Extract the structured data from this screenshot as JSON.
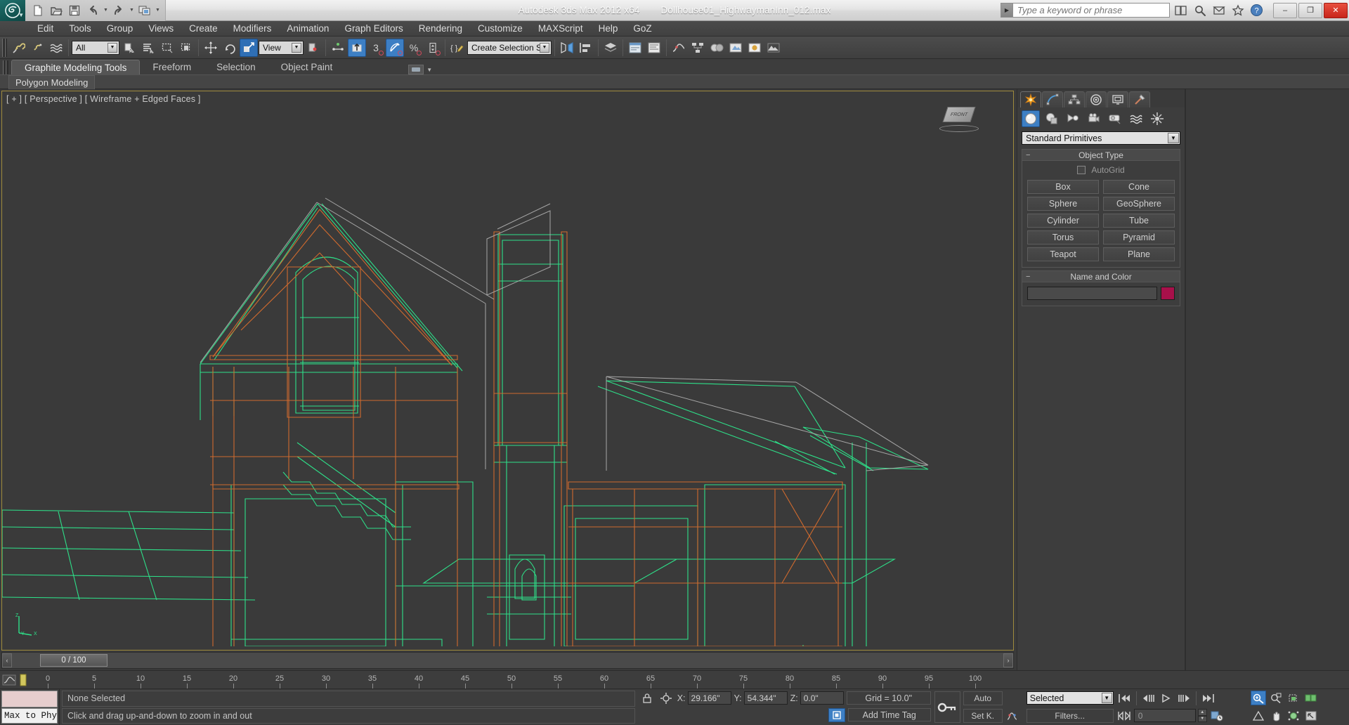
{
  "titlebar": {
    "app_title": "Autodesk 3ds Max  2012 x64",
    "file_name": "Dollhouse01_HighwaymanInn_012.max",
    "search_placeholder": "Type a keyword or phrase",
    "quick_access": [
      {
        "name": "new-file-icon",
        "label": "New"
      },
      {
        "name": "open-file-icon",
        "label": "Open"
      },
      {
        "name": "save-file-icon",
        "label": "Save"
      },
      {
        "name": "undo-icon",
        "label": "Undo"
      },
      {
        "name": "redo-icon",
        "label": "Redo"
      },
      {
        "name": "project-folder-icon",
        "label": "Set Project Folder"
      }
    ],
    "window_buttons": [
      "minimize",
      "restore",
      "close"
    ],
    "minimize_glyph": "–",
    "restore_glyph": "❐",
    "close_glyph": "✕"
  },
  "menu": {
    "items": [
      {
        "label": "Edit"
      },
      {
        "label": "Tools"
      },
      {
        "label": "Group"
      },
      {
        "label": "Views"
      },
      {
        "label": "Create"
      },
      {
        "label": "Modifiers"
      },
      {
        "label": "Animation"
      },
      {
        "label": "Graph Editors"
      },
      {
        "label": "Rendering"
      },
      {
        "label": "Customize"
      },
      {
        "label": "MAXScript"
      },
      {
        "label": "Help"
      },
      {
        "label": "GoZ"
      }
    ]
  },
  "toolbar": {
    "selection_filter_value": "All",
    "reference_coord_value": "View",
    "named_selection_value": "Create Selection Se",
    "snap_count_label": "3",
    "percent_label": "%",
    "curly_label": "{ }"
  },
  "ribbon": {
    "tabs": [
      {
        "label": "Graphite Modeling Tools",
        "active": true
      },
      {
        "label": "Freeform",
        "active": false
      },
      {
        "label": "Selection",
        "active": false
      },
      {
        "label": "Object Paint",
        "active": false
      }
    ],
    "subtab": "Polygon Modeling"
  },
  "viewport": {
    "label": "[ + ] [ Perspective ] [ Wireframe + Edged Faces ]",
    "viewcube_face": "FRONT",
    "axis_labels": {
      "x": "X",
      "y": "Y",
      "z": "Z"
    },
    "colors": {
      "background": "#3a3a3a",
      "border_active": "#9f8b3d",
      "wire_green": "#2ee089",
      "wire_orange": "#cf6a2e",
      "wire_gray": "#b9b9b9"
    }
  },
  "command_panel": {
    "tabs": [
      {
        "name": "create-tab",
        "icon": "star-icon",
        "active": true
      },
      {
        "name": "modify-tab",
        "icon": "curve-icon",
        "active": false
      },
      {
        "name": "hierarchy-tab",
        "icon": "hierarchy-icon",
        "active": false
      },
      {
        "name": "motion-tab",
        "icon": "wheel-icon",
        "active": false
      },
      {
        "name": "display-tab",
        "icon": "display-icon",
        "active": false
      },
      {
        "name": "utilities-tab",
        "icon": "hammer-icon",
        "active": false
      }
    ],
    "categories": [
      {
        "name": "geometry-category",
        "icon": "sphere-icon",
        "active": true
      },
      {
        "name": "shapes-category",
        "icon": "shapes-icon",
        "active": false
      },
      {
        "name": "lights-category",
        "icon": "light-icon",
        "active": false
      },
      {
        "name": "cameras-category",
        "icon": "camera-icon",
        "active": false
      },
      {
        "name": "helpers-category",
        "icon": "tape-icon",
        "active": false
      },
      {
        "name": "space-warps-category",
        "icon": "waves-icon",
        "active": false
      },
      {
        "name": "systems-category",
        "icon": "systems-icon",
        "active": false
      }
    ],
    "primitive_dropdown": "Standard Primitives",
    "object_type": {
      "title": "Object Type",
      "autogrid_label": "AutoGrid",
      "autogrid_checked": false,
      "buttons": [
        "Box",
        "Cone",
        "Sphere",
        "GeoSphere",
        "Cylinder",
        "Tube",
        "Torus",
        "Pyramid",
        "Teapot",
        "Plane"
      ]
    },
    "name_and_color": {
      "title": "Name and Color",
      "name_value": "",
      "color_hex": "#a8104a"
    }
  },
  "timeline": {
    "current_frame_label": "0 / 100",
    "prev_arrow": "‹",
    "next_arrow": "›",
    "ruler_ticks": [
      "0",
      "5",
      "10",
      "15",
      "20",
      "25",
      "30",
      "35",
      "40",
      "45",
      "50",
      "55",
      "60",
      "65",
      "70",
      "75",
      "80",
      "85",
      "90",
      "95",
      "100"
    ]
  },
  "statusbar": {
    "max_to_phys_label": "Max to Phy",
    "selection_status": "None Selected",
    "prompt": "Click and drag up-and-down to zoom in and out",
    "coords": {
      "x_label": "X:",
      "x_value": "29.166\"",
      "y_label": "Y:",
      "y_value": "54.344\"",
      "z_label": "Z:",
      "z_value": "0.0\""
    },
    "grid_label": "Grid = 10.0\"",
    "add_time_tag": "Add Time Tag",
    "auto_key_label": "Auto",
    "set_key_label": "Set K.",
    "key_filter_value": "Selected",
    "filters_label": "Filters...",
    "frame_field_value": "0"
  }
}
